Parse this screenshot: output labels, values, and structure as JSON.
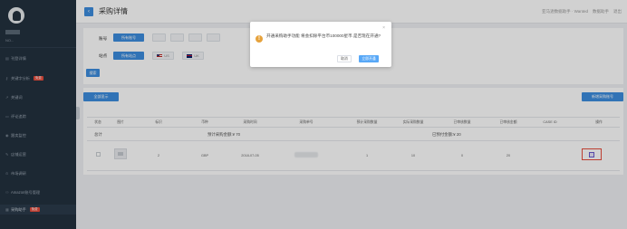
{
  "sidebar": {
    "user_name": "NO...",
    "items": [
      {
        "label": "刊登详情",
        "icon": "list-icon",
        "badge": ""
      },
      {
        "label": "关键字分析",
        "icon": "key-icon",
        "badge": "免费"
      },
      {
        "label": "关键词",
        "icon": "chart-icon",
        "badge": ""
      },
      {
        "label": "评论追踪",
        "icon": "comment-icon",
        "badge": ""
      },
      {
        "label": "跟卖监控",
        "icon": "eye-icon",
        "badge": ""
      },
      {
        "label": "店铺运营",
        "icon": "gear-icon",
        "badge": ""
      },
      {
        "label": "市场调研",
        "icon": "search-icon",
        "badge": ""
      },
      {
        "label": "Amazon账号管理",
        "icon": "user-icon",
        "badge": ""
      },
      {
        "label": "采购助手",
        "icon": "cart-icon",
        "badge": "免费"
      }
    ]
  },
  "topbar": {
    "title": "采购详情",
    "right_items": [
      "亚马逊数据助手 · Wanted",
      "数据助手",
      "退出"
    ]
  },
  "filter": {
    "row1_label": "账号",
    "row1_btn": "所有账号",
    "row2_label": "站点",
    "row2_btn": "所有站点",
    "sites": [
      "US",
      "UK"
    ],
    "search_btn": "搜索"
  },
  "actions": {
    "left_btn": "全部显示",
    "right_btn": "新增采购账号"
  },
  "table": {
    "headers": [
      "状态",
      "图片",
      "标识",
      "币种",
      "采购时间",
      "采购单号",
      "预计采购数量",
      "实际采购数量",
      "已审核数量",
      "已审核金额",
      "CASE ID",
      "操作"
    ],
    "total_label": "总计",
    "total_amount": "预计采购金额:¥ 70",
    "total_approved": "已预付金额:¥ 20",
    "row": [
      "",
      "",
      "2",
      "GBP",
      "2018-07-05",
      "",
      "1",
      "10",
      "0",
      "20",
      "",
      ""
    ]
  },
  "modal": {
    "message": "开通采购助手功能 将会扣除平台币100000星币.是否现在开通?",
    "cancel": "取消",
    "confirm": "立即开通"
  },
  "colors": {
    "sidebar_bg": "#23313f",
    "primary": "#3c8dde",
    "warning": "#e6a23c",
    "danger": "#e74c3c"
  }
}
